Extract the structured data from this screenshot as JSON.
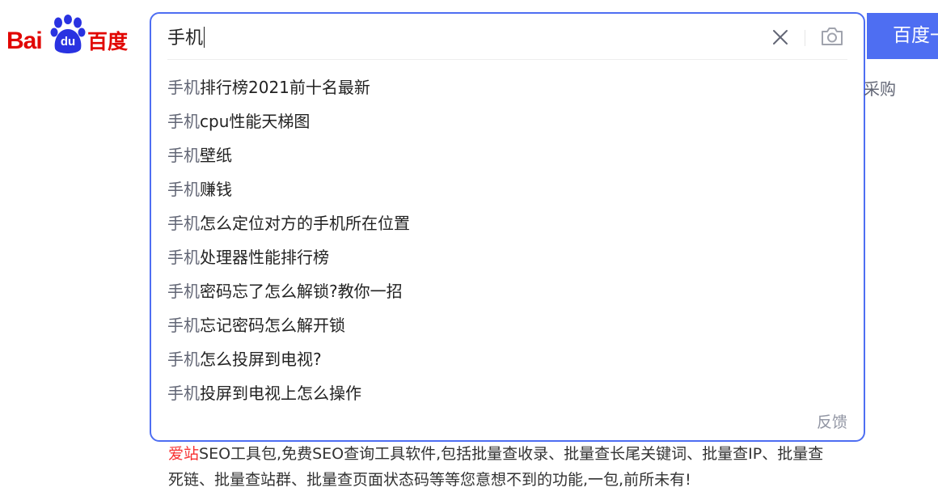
{
  "logo": {
    "latin": "Bai",
    "paw_text": "du",
    "chinese": "百度"
  },
  "search": {
    "query": "手机",
    "button_label": "百度一下"
  },
  "suggestions": [
    {
      "prefix": "手机",
      "rest": "排行榜2021前十名最新"
    },
    {
      "prefix": "手机",
      "rest": "cpu性能天梯图"
    },
    {
      "prefix": "手机",
      "rest": "壁纸"
    },
    {
      "prefix": "手机",
      "rest": "赚钱"
    },
    {
      "prefix": "手机",
      "rest": "怎么定位对方的手机所在位置"
    },
    {
      "prefix": "手机",
      "rest": "处理器性能排行榜"
    },
    {
      "prefix": "手机",
      "rest": "密码忘了怎么解锁?教你一招"
    },
    {
      "prefix": "手机",
      "rest": "忘记密码怎么解开锁"
    },
    {
      "prefix": "手机",
      "rest": "怎么投屏到电视?"
    },
    {
      "prefix": "手机",
      "rest": "投屏到电视上怎么操作"
    }
  ],
  "feedback_label": "反馈",
  "right_link": "采购",
  "result": {
    "highlight": "爱站",
    "text_line1": "SEO工具包,免费SEO查询工具软件,包括批量查收录、批量查长尾关键词、批量查IP、批量查",
    "text_line2": "死链、批量查站群、批量查页面状态码等等您意想不到的功能,一包,前所未有!"
  },
  "icons": {
    "clear": "close-icon",
    "camera": "camera-icon",
    "logo_paw": "paw-icon"
  },
  "colors": {
    "brand_blue": "#4e6ef2",
    "brand_red": "#e10602",
    "logo_blue": "#2932e1",
    "highlight_red": "#f73131"
  }
}
